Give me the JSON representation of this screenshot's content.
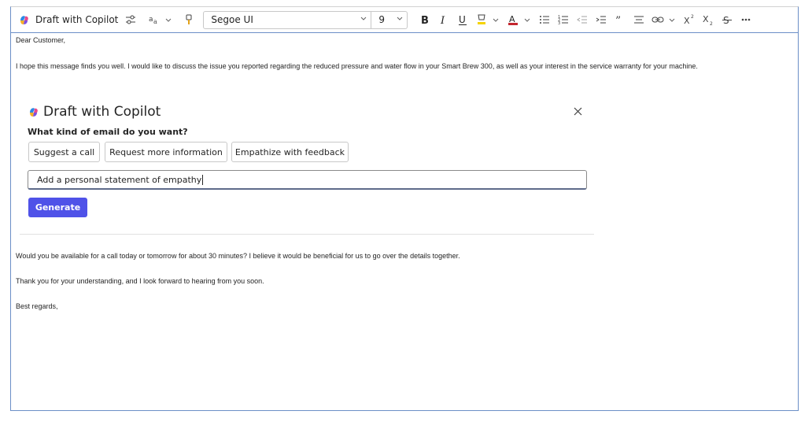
{
  "toolbar": {
    "copilot_label": "Draft with Copilot",
    "font_name": "Segoe UI",
    "font_size": "9",
    "highlight_color": "#f5d300",
    "font_color": "#c4262e",
    "superscript_label": "X",
    "subscript_label": "X"
  },
  "email": {
    "greeting": "Dear Customer,",
    "para1": "I hope this message finds you well. I would like to discuss the issue you reported regarding the reduced pressure and water flow in your Smart Brew 300, as well as your interest in the service warranty for your machine.",
    "para2": "Would you be available for a call today or tomorrow for about 30 minutes? I believe it would be beneficial for us to go over the details together.",
    "para3": "Thank you for your understanding, and I look forward to hearing from you soon.",
    "closing": "Best regards,"
  },
  "copilot_panel": {
    "title": "Draft with Copilot",
    "question": "What kind of email do you want?",
    "suggestions": [
      "Suggest a call",
      "Request more information",
      "Empathize with feedback"
    ],
    "input_value": "Add a personal statement of empathy",
    "generate_label": "Generate",
    "accent": "#4f52e8"
  }
}
